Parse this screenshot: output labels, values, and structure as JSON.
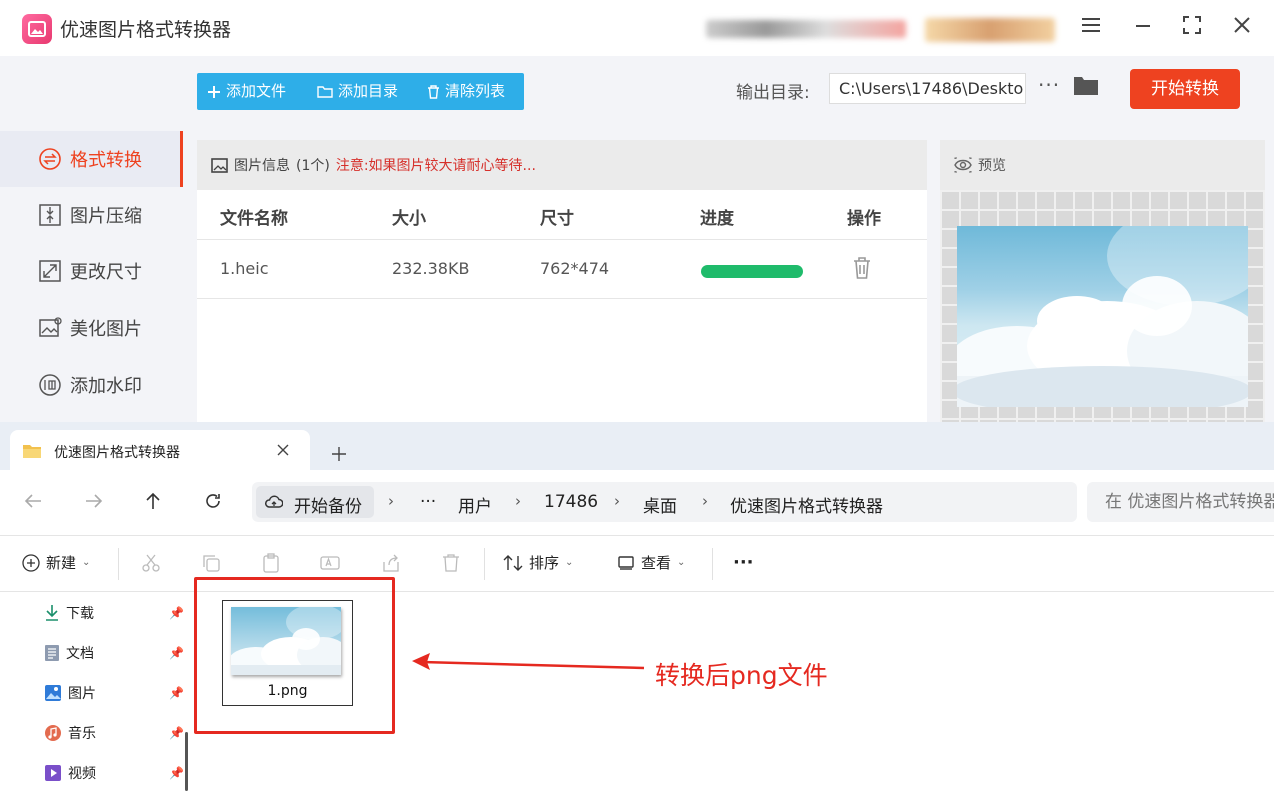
{
  "app": {
    "title": "优速图片格式转换器",
    "toolbar": {
      "add_file": "添加文件",
      "add_folder": "添加目录",
      "clear_list": "清除列表",
      "output_label": "输出目录:",
      "output_path": "C:\\Users\\17486\\Deskto",
      "more": "···",
      "start": "开始转换"
    },
    "sidebar": [
      {
        "label": "格式转换",
        "icon": "swap-circle-icon",
        "active": true
      },
      {
        "label": "图片压缩",
        "icon": "compress-icon",
        "active": false
      },
      {
        "label": "更改尺寸",
        "icon": "resize-icon",
        "active": false
      },
      {
        "label": "美化图片",
        "icon": "beautify-icon",
        "active": false
      },
      {
        "label": "添加水印",
        "icon": "watermark-icon",
        "active": false
      }
    ],
    "list": {
      "header_label": "图片信息",
      "header_count": "(1个)",
      "notice": "注意:如果图片较大请耐心等待...",
      "columns": [
        "文件名称",
        "大小",
        "尺寸",
        "进度",
        "操作"
      ],
      "rows": [
        {
          "name": "1.heic",
          "size": "232.38KB",
          "dimensions": "762*474",
          "progress": 1.0
        }
      ]
    },
    "preview": {
      "label": "预览"
    },
    "colors": {
      "accent": "#ee4220",
      "toolbar_blue": "#2eaee8",
      "progress_green": "#1fbb6b"
    }
  },
  "explorer": {
    "tab_title": "优速图片格式转换器",
    "breadcrumb": [
      "开始备份",
      "···",
      "用户",
      "17486",
      "桌面",
      "优速图片格式转换器"
    ],
    "search_placeholder": "在 优速图片格式转换器",
    "commands": {
      "new": "新建",
      "sort": "排序",
      "view": "查看",
      "more": "···"
    },
    "nav": [
      {
        "label": "下载",
        "icon": "download-icon"
      },
      {
        "label": "文档",
        "icon": "document-icon"
      },
      {
        "label": "图片",
        "icon": "pictures-icon"
      },
      {
        "label": "音乐",
        "icon": "music-icon"
      },
      {
        "label": "视频",
        "icon": "video-icon"
      }
    ],
    "file": {
      "name": "1.png"
    },
    "annotation": "转换后png文件"
  }
}
